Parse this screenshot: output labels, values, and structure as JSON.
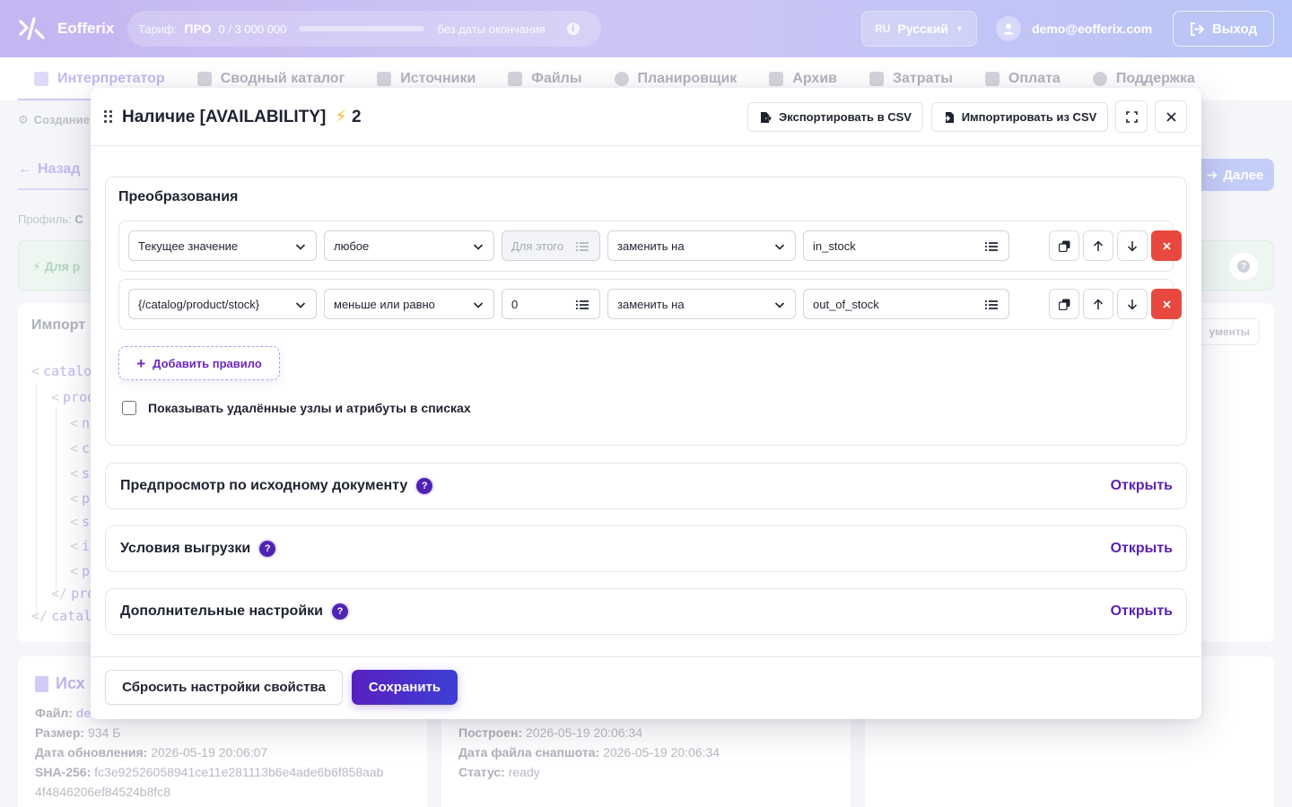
{
  "app": {
    "brand": "Eofferix",
    "plan": {
      "label": "Тариф:",
      "name": "ПРО",
      "usage": "0 / 3 000 000",
      "expiry": "без даты окончания",
      "usage_fraction": 0
    },
    "language": {
      "code": "RU",
      "name": "Русский"
    },
    "user_email": "demo@eofferix.com",
    "logout_label": "Выход"
  },
  "nav": {
    "items": [
      {
        "label": "Интерпретатор",
        "icon": "wand-icon",
        "active": true
      },
      {
        "label": "Сводный каталог",
        "icon": "boxes-icon"
      },
      {
        "label": "Источники",
        "icon": "layers-icon"
      },
      {
        "label": "Файлы",
        "icon": "files-icon"
      },
      {
        "label": "Планировщик",
        "icon": "clock-icon"
      },
      {
        "label": "Архив",
        "icon": "archive-icon"
      },
      {
        "label": "Затраты",
        "icon": "coins-icon"
      },
      {
        "label": "Оплата",
        "icon": "card-icon"
      },
      {
        "label": "Поддержка",
        "icon": "headset-icon"
      }
    ]
  },
  "background": {
    "crumb": "Создание",
    "back_label": "Назад",
    "next_label": "Далее",
    "profile_label": "Профиль:",
    "profile_value": "С",
    "hint_text": "Для р",
    "import_title": "Импорт",
    "arguments_label": "ументы",
    "xml_lines": [
      "catalo",
      "prod",
      "n",
      "c",
      "s",
      "p",
      "s",
      "i",
      "p",
      "pro",
      "catal"
    ],
    "source_title": "Исх",
    "file_label": "Файл:",
    "file_value": "de",
    "size_label": "Размер:",
    "size_value": "934 Б",
    "updated_label": "Дата обновления:",
    "updated_value": "2026-05-19 20:06:07",
    "sha_label": "SHA-256:",
    "sha_value_1": "fc3e92526058941ce11e281113b6e4ade6b6f858aab",
    "sha_value_2": "4f4846206ef84524b8fc8",
    "built_label": "Построен:",
    "built_value": "2026-05-19 20:06:34",
    "snapshot_label": "Дата файла снапшота:",
    "snapshot_value": "2026-05-19 20:06:34",
    "status_label": "Статус:",
    "status_value": "ready"
  },
  "modal": {
    "title": "Наличие [AVAILABILITY]",
    "bolt_icon": "lightning-icon",
    "bolt_count": "2",
    "export_label": "Экспортировать в CSV",
    "import_label": "Импортировать из CSV",
    "section_title": "Преобразования",
    "rules": [
      {
        "source": "Текущее значение",
        "condition": "любое",
        "operand": "",
        "operand_placeholder": "Для этого",
        "action": "заменить на",
        "result": "in_stock"
      },
      {
        "source": "{/catalog/product/stock}",
        "condition": "меньше или равно",
        "operand": "0",
        "operand_placeholder": "",
        "action": "заменить на",
        "result": "out_of_stock"
      }
    ],
    "add_rule_label": "Добавить правило",
    "show_deleted_label": "Показывать удалённые узлы и атрибуты в списках",
    "show_deleted_checked": false,
    "accordions": [
      {
        "title": "Предпросмотр по исходному документу",
        "action": "Открыть"
      },
      {
        "title": "Условия выгрузки",
        "action": "Открыть"
      },
      {
        "title": "Дополнительные настройки",
        "action": "Открыть"
      }
    ],
    "reset_label": "Сбросить настройки свойства",
    "save_label": "Сохранить"
  },
  "colors": {
    "accent": "#5b1fb5",
    "save_gradient_start": "#5a1fc0",
    "save_gradient_end": "#3d3fd6",
    "danger": "#e8493f",
    "bolt": "#f3bd2e"
  }
}
